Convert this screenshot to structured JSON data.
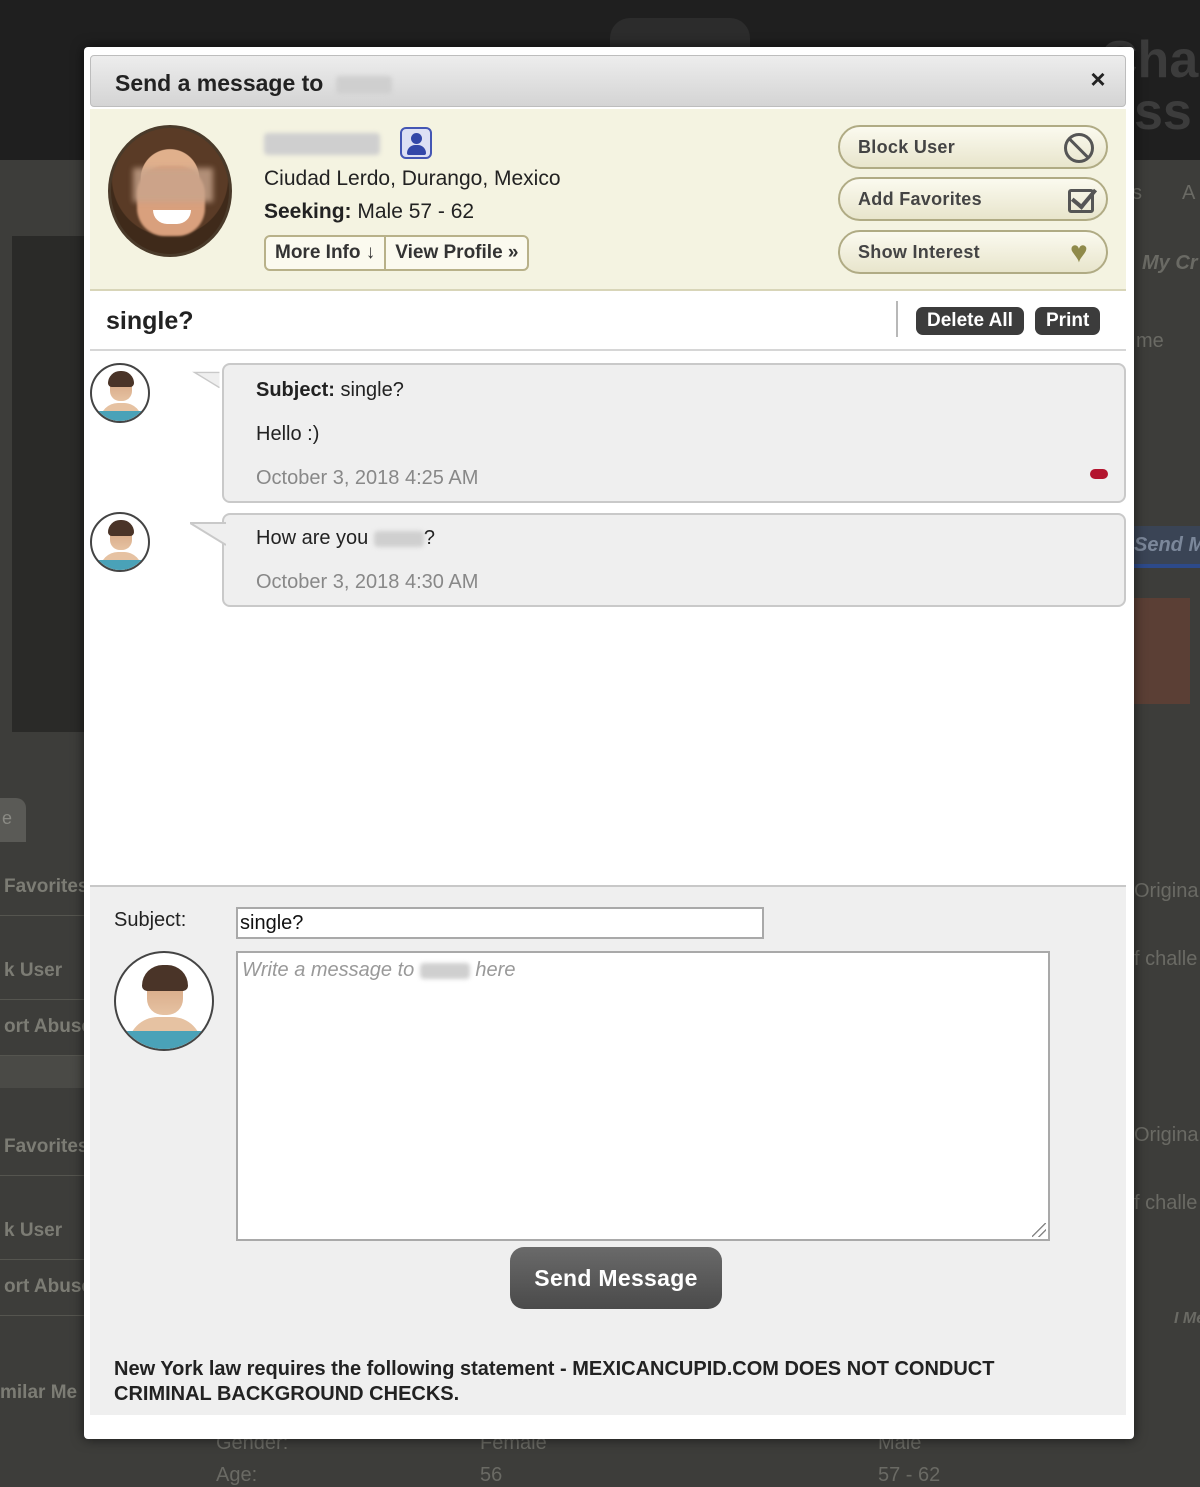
{
  "background": {
    "header_text_1": "Chan",
    "header_text_2": "ss",
    "left_tab": "e",
    "left_items": [
      "Favorites",
      "k User",
      "ort Abuse",
      "Favorites",
      "k User",
      "ort Abuse"
    ],
    "similar": "milar Me",
    "right_texts": [
      "s",
      "A",
      "My Cr",
      "me",
      "Origina",
      "f challe",
      "Origina",
      "f challe",
      "I Me"
    ],
    "right_send": "Send M",
    "bottom": {
      "gender_label": "Gender:",
      "gender_value": "Female",
      "seeking_value": "Male",
      "age_label": "Age:",
      "age_value": "56",
      "age_range": "57 - 62"
    }
  },
  "modal": {
    "title": "Send a message to",
    "close_label": "×",
    "profile": {
      "location": "Ciudad Lerdo, Durango, Mexico",
      "seeking_label": "Seeking:",
      "seeking_value": "Male 57 - 62",
      "more_info_label": "More Info ↓",
      "view_profile_label": "View Profile »"
    },
    "actions": {
      "block_label": "Block User",
      "favorites_label": "Add Favorites",
      "interest_label": "Show Interest",
      "heart_glyph": "♥"
    },
    "thread": {
      "subject": "single?",
      "delete_all_label": "Delete All",
      "print_label": "Print"
    },
    "messages": [
      {
        "subject_label": "Subject:",
        "subject": "single?",
        "body": "Hello :)",
        "date": "October 3, 2018 4:25 AM"
      },
      {
        "body_prefix": "How are you",
        "body_suffix": "?",
        "date": "October 3, 2018 4:30 AM"
      }
    ],
    "compose": {
      "subject_label": "Subject:",
      "subject_value": "single?",
      "placeholder_prefix": "Write a message to",
      "placeholder_suffix": "here",
      "send_label": "Send Message"
    },
    "law_note": "New York law requires the following statement - MEXICANCUPID.COM DOES NOT CONDUCT CRIMINAL BACKGROUND CHECKS."
  },
  "colors": {
    "unread": "#b3142e",
    "profile_bg": "#f4f3e1",
    "accent_icon": "#3347a8"
  }
}
